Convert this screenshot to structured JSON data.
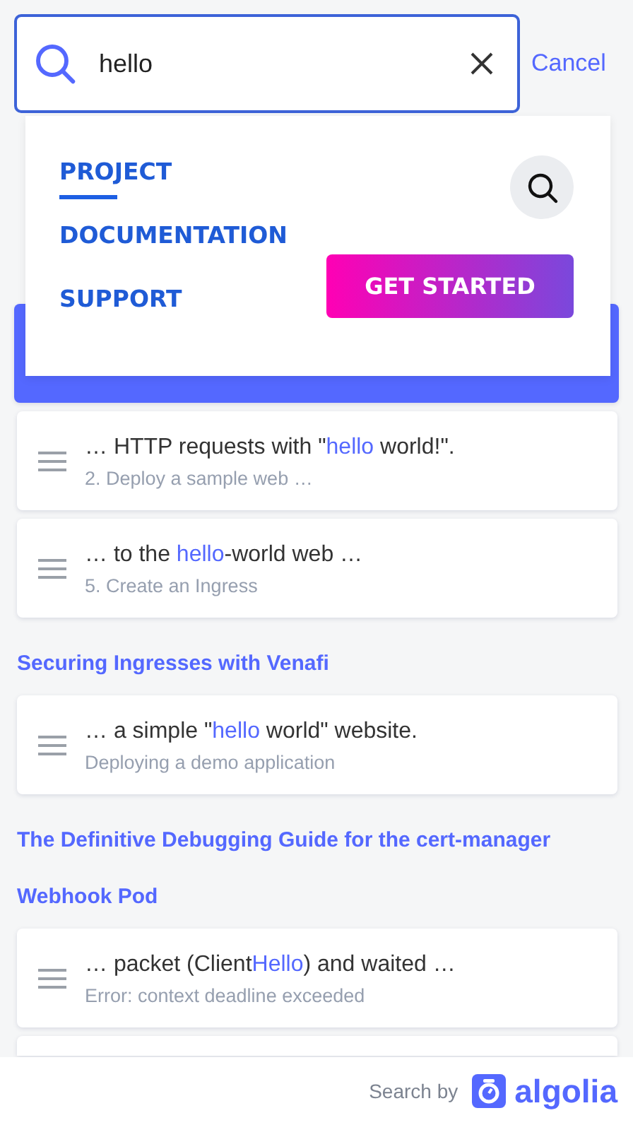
{
  "search": {
    "value": "hello",
    "cancel": "Cancel"
  },
  "menu": {
    "links": [
      {
        "label": "PROJECT",
        "selected": true
      },
      {
        "label": "DOCUMENTATION",
        "selected": false
      },
      {
        "label": "SUPPORT",
        "selected": false
      }
    ],
    "cta": "GET STARTED"
  },
  "results": [
    {
      "hits": [
        {
          "selected": true
        },
        {
          "selected": false,
          "title": [
            {
              "text": "… HTTP requests with \"",
              "highlight": false
            },
            {
              "text": "hello",
              "highlight": true
            },
            {
              "text": " world!\".",
              "highlight": false
            }
          ],
          "subtitle": "2. Deploy a sample web …"
        },
        {
          "selected": false,
          "title": [
            {
              "text": "… to the ",
              "highlight": false
            },
            {
              "text": "hello",
              "highlight": true
            },
            {
              "text": "-world web …",
              "highlight": false
            }
          ],
          "subtitle": "5. Create an Ingress"
        }
      ]
    },
    {
      "heading": "Securing Ingresses with Venafi",
      "hits": [
        {
          "selected": false,
          "title": [
            {
              "text": "… a simple \"",
              "highlight": false
            },
            {
              "text": "hello",
              "highlight": true
            },
            {
              "text": " world\" website.",
              "highlight": false
            }
          ],
          "subtitle": "Deploying a demo application"
        }
      ]
    },
    {
      "heading": "The Definitive Debugging Guide for the cert-manager Webhook Pod",
      "hits": [
        {
          "selected": false,
          "title": [
            {
              "text": "… packet (Client",
              "highlight": false
            },
            {
              "text": "Hello",
              "highlight": true
            },
            {
              "text": ") and waited …",
              "highlight": false
            }
          ],
          "subtitle": "Error: context deadline exceeded"
        },
        {
          "selected": false
        }
      ]
    }
  ],
  "footer": {
    "label": "Search by",
    "brand": "algolia"
  }
}
